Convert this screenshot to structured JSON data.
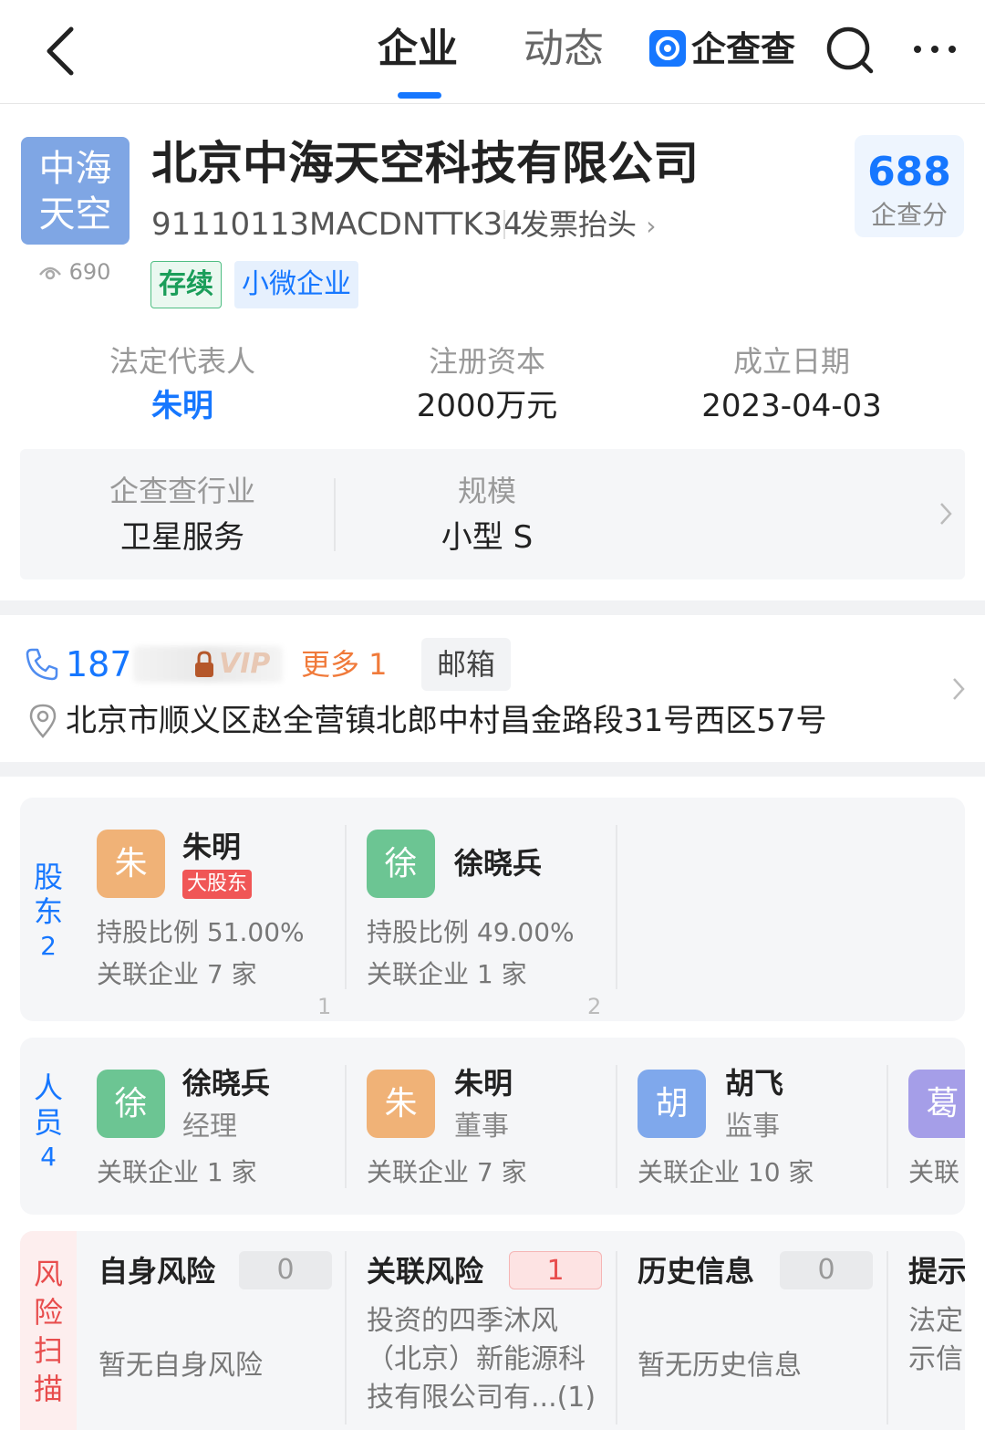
{
  "header": {
    "tabs": [
      {
        "label": "企业"
      },
      {
        "label": "动态"
      }
    ],
    "brand": "企查查"
  },
  "company": {
    "logo_text": [
      "中海",
      "天空"
    ],
    "views": "690",
    "name": "北京中海天空科技有限公司",
    "credit_code": "91110113MACDNTTK34",
    "invoice_label": "发票抬头",
    "tags": [
      "存续",
      "小微企业"
    ],
    "score": "688",
    "score_label": "企查分",
    "legal_rep_label": "法定代表人",
    "legal_rep": "朱明",
    "capital_label": "注册资本",
    "capital": "2000万元",
    "founded_label": "成立日期",
    "founded": "2023-04-03",
    "industry_label": "企查查行业",
    "industry": "卫星服务",
    "scale_label": "规模",
    "scale": "小型 S"
  },
  "contact": {
    "phone": "187",
    "vip": "VIP",
    "more": "更多 1",
    "email": "邮箱",
    "address": "北京市顺义区赵全营镇北郎中村昌金路段31号西区57号"
  },
  "shareholders": {
    "side": [
      "股",
      "东"
    ],
    "count": "2",
    "items": [
      {
        "avatar": "朱",
        "name": "朱明",
        "badge": "大股东",
        "ratio": "持股比例 51.00%",
        "related": "关联企业 7 家",
        "index": "1"
      },
      {
        "avatar": "徐",
        "name": "徐晓兵",
        "ratio": "持股比例 49.00%",
        "related": "关联企业 1 家",
        "index": "2"
      }
    ]
  },
  "staff": {
    "side": [
      "人",
      "员"
    ],
    "count": "4",
    "items": [
      {
        "avatar": "徐",
        "name": "徐晓兵",
        "role": "经理",
        "related": "关联企业 1 家"
      },
      {
        "avatar": "朱",
        "name": "朱明",
        "role": "董事",
        "related": "关联企业 7 家"
      },
      {
        "avatar": "胡",
        "name": "胡飞",
        "role": "监事",
        "related": "关联企业 10 家"
      },
      {
        "avatar": "葛",
        "related": "关联"
      }
    ]
  },
  "risk": {
    "side": [
      "风",
      "险",
      "扫",
      "描"
    ],
    "items": [
      {
        "title": "自身风险",
        "count": "0",
        "text": "暂无自身风险"
      },
      {
        "title": "关联风险",
        "count": "1",
        "text": [
          "投资的四季沐风",
          "（北京）新能源科",
          "技有限公司有...(1)"
        ]
      },
      {
        "title": "历史信息",
        "count": "0",
        "text": "暂无历史信息"
      },
      {
        "title": "提示",
        "text": [
          "法定",
          "示信"
        ]
      }
    ]
  }
}
